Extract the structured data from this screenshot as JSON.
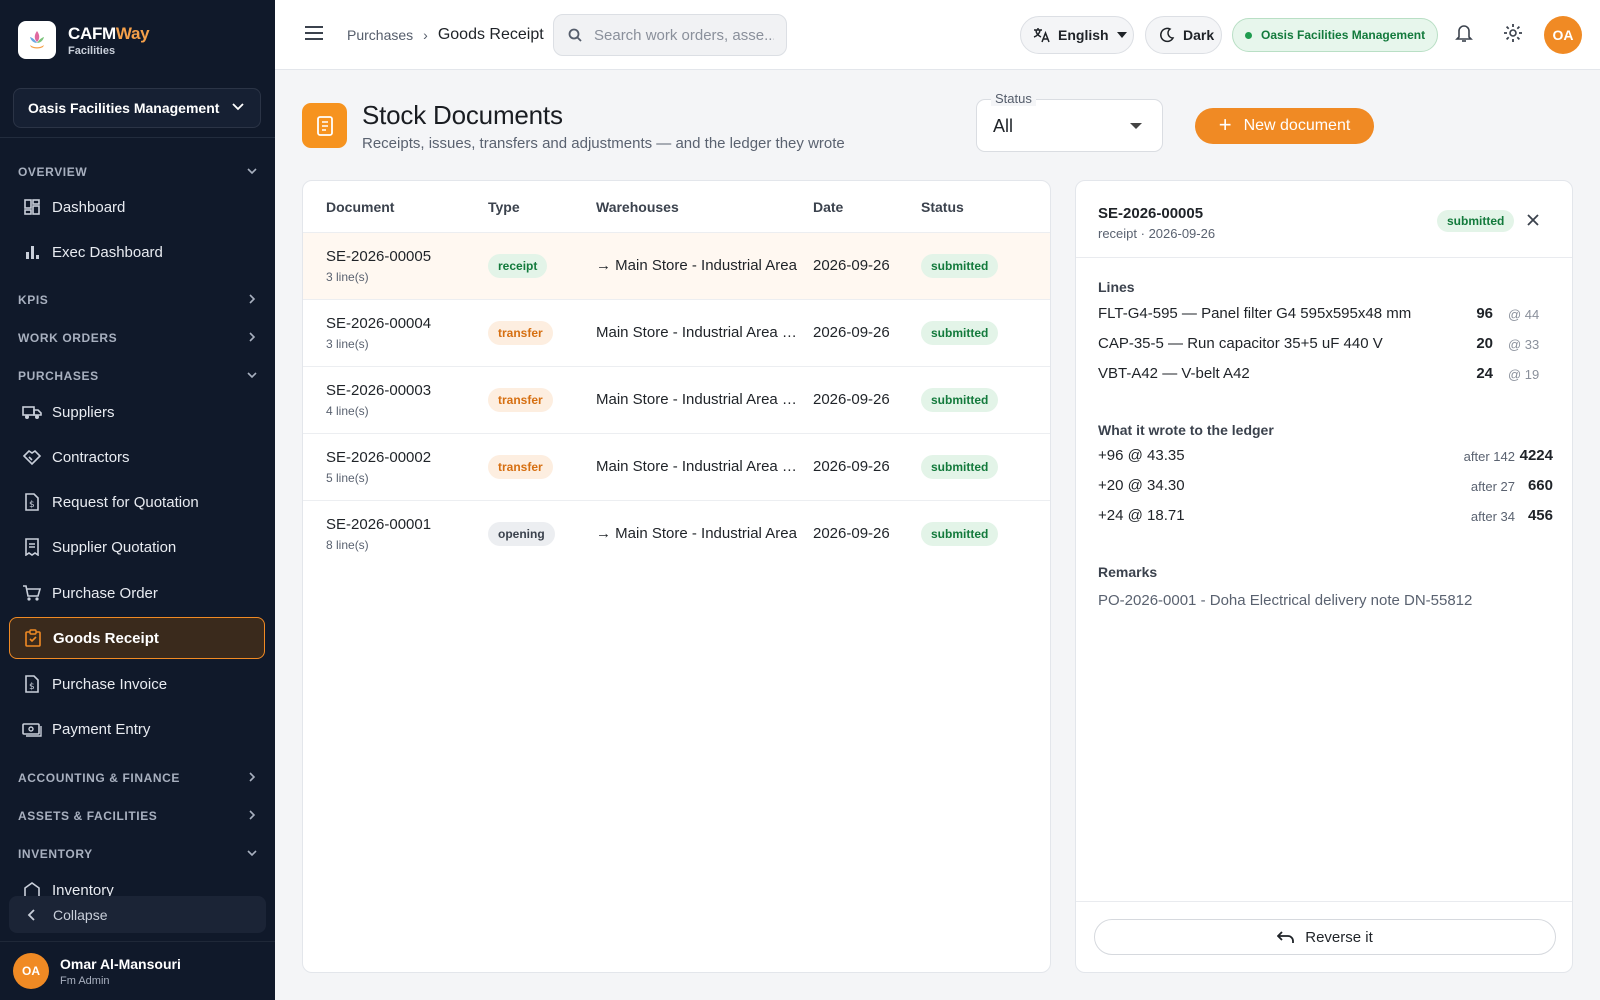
{
  "brand": {
    "name_main": "CAFM",
    "name_accent": "Way",
    "subtitle": "Facilities"
  },
  "sidebar": {
    "org": "Oasis Facilities Management",
    "sections": {
      "overview": "OVERVIEW",
      "kpis": "KPIS",
      "work_orders": "WORK ORDERS",
      "purchases": "PURCHASES",
      "accounting": "ACCOUNTING & FINANCE",
      "assets": "ASSETS & FACILITIES",
      "inventory": "INVENTORY"
    },
    "items": {
      "dashboard": "Dashboard",
      "exec_dashboard": "Exec Dashboard",
      "suppliers": "Suppliers",
      "contractors": "Contractors",
      "rfq": "Request for Quotation",
      "supplier_quotation": "Supplier Quotation",
      "purchase_order": "Purchase Order",
      "goods_receipt": "Goods Receipt",
      "purchase_invoice": "Purchase Invoice",
      "payment_entry": "Payment Entry",
      "inventory": "Inventory"
    },
    "collapse_label": "Collapse",
    "user": {
      "initials": "OA",
      "name": "Omar Al-Mansouri",
      "role": "Fm Admin"
    }
  },
  "topbar": {
    "breadcrumb": [
      "Purchases",
      "Goods Receipt"
    ],
    "search_placeholder": "Search work orders, asse...",
    "language": "English",
    "theme": "Dark",
    "org_badge": "Oasis Facilities Management",
    "avatar_initials": "OA"
  },
  "page": {
    "title": "Stock Documents",
    "subtitle": "Receipts, issues, transfers and adjustments — and the ledger they wrote",
    "status_filter": {
      "label": "Status",
      "value": "All"
    },
    "new_button": "New document"
  },
  "table": {
    "columns": [
      "Document",
      "Type",
      "Warehouses",
      "Date",
      "Status"
    ],
    "rows": [
      {
        "doc": "SE-2026-00005",
        "lines": "3 line(s)",
        "type": "receipt",
        "warehouses": "→ Main Store - Industrial Area",
        "date": "2026-09-26",
        "status": "submitted"
      },
      {
        "doc": "SE-2026-00004",
        "lines": "3 line(s)",
        "type": "transfer",
        "warehouses": "Main Store - Industrial Area → …",
        "date": "2026-09-26",
        "status": "submitted"
      },
      {
        "doc": "SE-2026-00003",
        "lines": "4 line(s)",
        "type": "transfer",
        "warehouses": "Main Store - Industrial Area → …",
        "date": "2026-09-26",
        "status": "submitted"
      },
      {
        "doc": "SE-2026-00002",
        "lines": "5 line(s)",
        "type": "transfer",
        "warehouses": "Main Store - Industrial Area → …",
        "date": "2026-09-26",
        "status": "submitted"
      },
      {
        "doc": "SE-2026-00001",
        "lines": "8 line(s)",
        "type": "opening",
        "warehouses": "→ Main Store - Industrial Area",
        "date": "2026-09-26",
        "status": "submitted"
      }
    ]
  },
  "detail": {
    "id": "SE-2026-00005",
    "meta": "receipt · 2026-09-26",
    "status": "submitted",
    "lines_label": "Lines",
    "lines": [
      {
        "item": "FLT-G4-595 — Panel filter G4 595x595x48 mm",
        "qty": "96",
        "rate": "@ 44"
      },
      {
        "item": "CAP-35-5 — Run capacitor 35+5 uF 440 V",
        "qty": "20",
        "rate": "@ 33"
      },
      {
        "item": "VBT-A42 — V-belt A42",
        "qty": "24",
        "rate": "@ 19"
      }
    ],
    "ledger_label": "What it wrote to the ledger",
    "ledger": [
      {
        "entry": "+96 @ 43.35",
        "after": "after 142",
        "value": "4224"
      },
      {
        "entry": "+20 @ 34.30",
        "after": "after 27",
        "value": "660"
      },
      {
        "entry": "+24 @ 18.71",
        "after": "after 34",
        "value": "456"
      }
    ],
    "remarks_label": "Remarks",
    "remarks": "PO-2026-0001 - Doha Electrical delivery note DN-55812",
    "reverse_button": "Reverse it"
  }
}
